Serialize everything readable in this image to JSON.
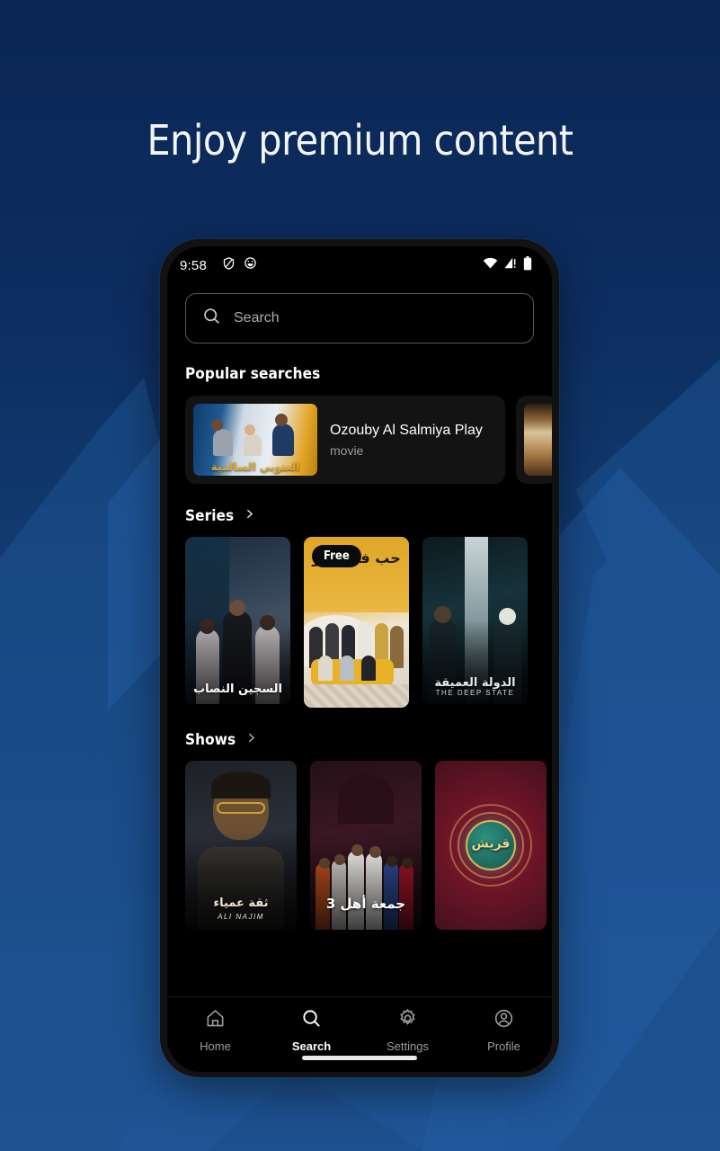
{
  "promo": {
    "headline": "Enjoy premium content",
    "bg_top_color": "#0a2654",
    "bg_bottom_color": "#1f5596",
    "chevron_color": "#1b4f8f"
  },
  "statusbar": {
    "time": "9:58",
    "icons_left": [
      "shield-icon",
      "emoji-face-icon"
    ],
    "icons_right": [
      "wifi-icon",
      "cellular-signal-icon",
      "battery-icon"
    ]
  },
  "search": {
    "placeholder": "Search",
    "icon": "search-icon"
  },
  "sections": {
    "popular": {
      "title": "Popular searches",
      "cards": [
        {
          "name": "Ozouby Al Salmiya Play",
          "kind": "movie",
          "thumb_title": "العتوبي السالمية"
        },
        {
          "name": "",
          "kind": "",
          "thumb_title": ""
        }
      ]
    },
    "series": {
      "title": "Series",
      "chevron": "chevron-right-icon",
      "posters": [
        {
          "ar_title": "السجين النصاب",
          "lat_title": "",
          "badge": ""
        },
        {
          "ar_title": "حب في سيو",
          "lat_title": "",
          "badge": "Free"
        },
        {
          "ar_title": "الدولة العميقة",
          "lat_title": "THE DEEP STATE",
          "badge": ""
        }
      ]
    },
    "shows": {
      "title": "Shows",
      "chevron": "chevron-right-icon",
      "posters": [
        {
          "ar_title": "ثقة عمياء",
          "lat_title": "ALI NAJIM",
          "badge": ""
        },
        {
          "ar_title": "جمعة أهل 3",
          "lat_title": "",
          "badge": ""
        },
        {
          "ar_title": "قريش",
          "lat_title": "",
          "badge": ""
        }
      ]
    }
  },
  "navbar": {
    "items": [
      {
        "label": "Home",
        "icon": "home-icon",
        "active": false
      },
      {
        "label": "Search",
        "icon": "search-icon",
        "active": true
      },
      {
        "label": "Settings",
        "icon": "gear-icon",
        "active": false
      },
      {
        "label": "Profile",
        "icon": "person-circle-icon",
        "active": false
      }
    ]
  }
}
